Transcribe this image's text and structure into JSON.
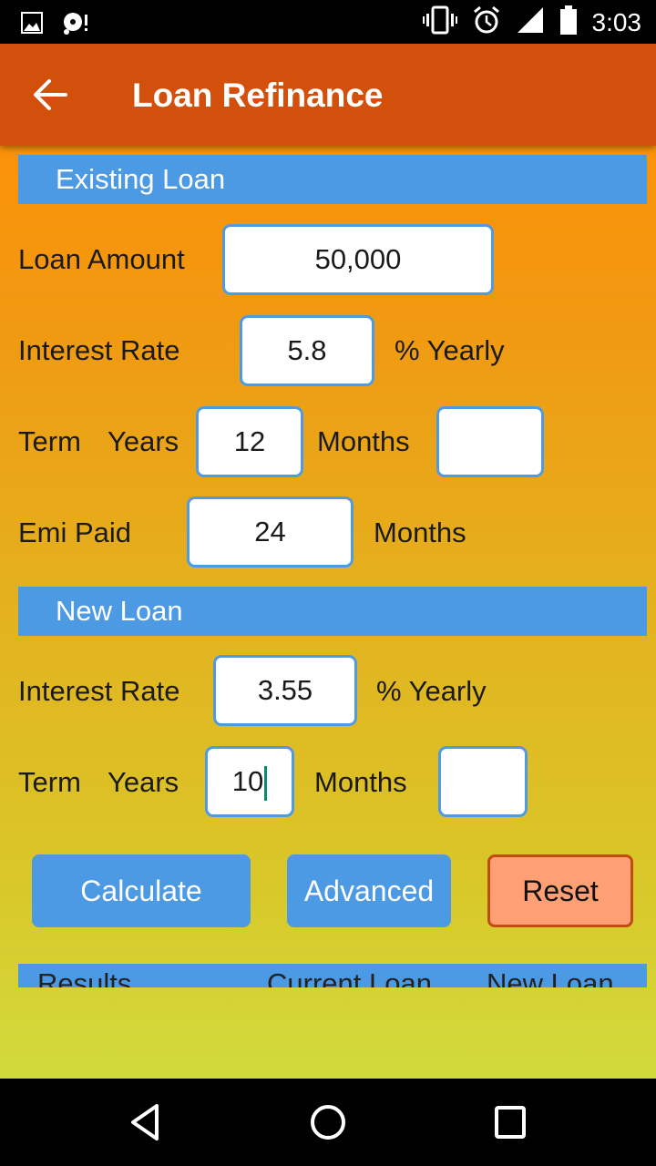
{
  "status_bar": {
    "left_icons": [
      "image-icon",
      "sync-alert-icon"
    ],
    "right_icons": [
      "vibrate-icon",
      "alarm-icon",
      "signal-icon",
      "battery-icon"
    ],
    "time": "3:03"
  },
  "app_bar": {
    "back_icon": "arrow-left-icon",
    "title": "Loan Refinance",
    "color": "#d3500c"
  },
  "existing_loan": {
    "header": "Existing Loan",
    "loan_amount_label": "Loan Amount",
    "loan_amount_value": "50,000",
    "interest_rate_label": "Interest Rate",
    "interest_rate_value": "5.8",
    "interest_rate_suffix": "% Yearly",
    "term_label": "Term",
    "years_label": "Years",
    "years_value": "12",
    "months_label": "Months",
    "months_value": "",
    "emi_paid_label": "Emi Paid",
    "emi_paid_value": "24",
    "emi_paid_suffix": "Months"
  },
  "new_loan": {
    "header": "New Loan",
    "interest_rate_label": "Interest Rate",
    "interest_rate_value": "3.55",
    "interest_rate_suffix": "% Yearly",
    "term_label": "Term",
    "years_label": "Years",
    "years_value": "10",
    "months_label": "Months",
    "months_value": ""
  },
  "buttons": {
    "calculate": "Calculate",
    "advanced": "Advanced",
    "reset": "Reset"
  },
  "results": {
    "columns": [
      "Results",
      "Current Loan",
      "New Loan"
    ]
  },
  "nav_bar": {
    "buttons": [
      "back-icon",
      "home-icon",
      "recents-icon"
    ]
  },
  "colors": {
    "section_header": "#4c99e4",
    "field_border": "#4f9be3",
    "reset_bg": "#ffa074",
    "reset_border": "#c04d10"
  }
}
